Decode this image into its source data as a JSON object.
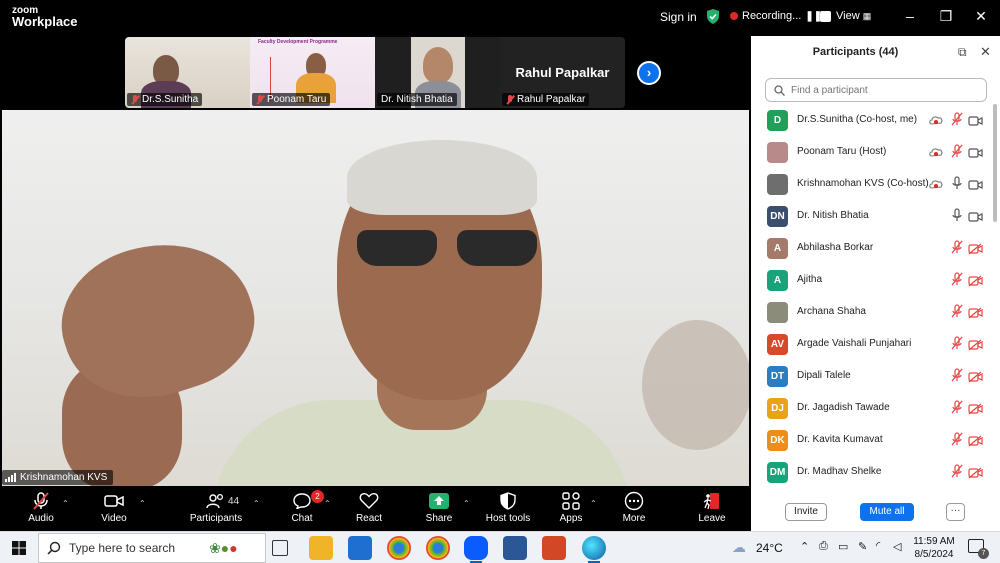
{
  "app": {
    "logo_line1": "zoom",
    "logo_line2": "Workplace",
    "sign_in": "Sign in",
    "recording_label": "Recording...",
    "view_label": "View"
  },
  "thumbnails": [
    {
      "name": "Dr.S.Sunitha",
      "muted": true
    },
    {
      "name": "Poonam Taru",
      "muted": true,
      "poster_title": "Faculty Development Programme"
    },
    {
      "name": "Dr. Nitish Bhatia",
      "muted": false
    },
    {
      "name": "Rahul Papalkar",
      "muted": true,
      "display_name": "Rahul Papalkar"
    }
  ],
  "main_video": {
    "speaker": "Krishnamohan KVS"
  },
  "toolbar": {
    "audio": "Audio",
    "video": "Video",
    "participants": "Participants",
    "participants_count": "44",
    "chat": "Chat",
    "chat_badge": "2",
    "react": "React",
    "share": "Share",
    "host_tools": "Host tools",
    "apps": "Apps",
    "more": "More",
    "leave": "Leave"
  },
  "panel": {
    "title": "Participants (44)",
    "search_placeholder": "Find a participant",
    "invite": "Invite",
    "mute_all": "Mute all",
    "more": "···",
    "participants": [
      {
        "initials": "D",
        "color": "#22a05a",
        "name": "Dr.S.Sunitha (Co-host, me)",
        "rec": true,
        "mic": "muted",
        "cam": "on"
      },
      {
        "initials": "",
        "color": "#b98a8a",
        "name": "Poonam Taru (Host)",
        "rec": true,
        "mic": "muted",
        "cam": "on"
      },
      {
        "initials": "",
        "color": "#6e6e6e",
        "name": "Krishnamohan KVS (Co-host)",
        "rec": true,
        "mic": "on",
        "cam": "on"
      },
      {
        "initials": "DN",
        "color": "#3a4f6e",
        "name": "Dr. Nitish Bhatia",
        "rec": false,
        "mic": "on",
        "cam": "on"
      },
      {
        "initials": "A",
        "color": "#a47b6a",
        "name": "Abhilasha Borkar",
        "rec": false,
        "mic": "muted",
        "cam": "off"
      },
      {
        "initials": "A",
        "color": "#1aa37a",
        "name": "Ajitha",
        "rec": false,
        "mic": "muted",
        "cam": "off"
      },
      {
        "initials": "",
        "color": "#8c8c7a",
        "name": "Archana Shaha",
        "rec": false,
        "mic": "muted",
        "cam": "off"
      },
      {
        "initials": "AV",
        "color": "#d64a2a",
        "name": "Argade Vaishali Punjahari",
        "rec": false,
        "mic": "muted",
        "cam": "off"
      },
      {
        "initials": "DT",
        "color": "#2b7ec1",
        "name": "Dipali Talele",
        "rec": false,
        "mic": "muted",
        "cam": "off"
      },
      {
        "initials": "DJ",
        "color": "#e8a317",
        "name": "Dr. Jagadish Tawade",
        "rec": false,
        "mic": "muted",
        "cam": "off"
      },
      {
        "initials": "DK",
        "color": "#f08c1a",
        "name": "Dr. Kavita Kumavat",
        "rec": false,
        "mic": "muted",
        "cam": "off"
      },
      {
        "initials": "DM",
        "color": "#1aa37a",
        "name": "Dr. Madhav Shelke",
        "rec": false,
        "mic": "muted",
        "cam": "off"
      }
    ]
  },
  "taskbar": {
    "search_placeholder": "Type here to search",
    "weather": "24°C",
    "time": "11:59 AM",
    "date": "8/5/2024",
    "notifications": "7"
  }
}
